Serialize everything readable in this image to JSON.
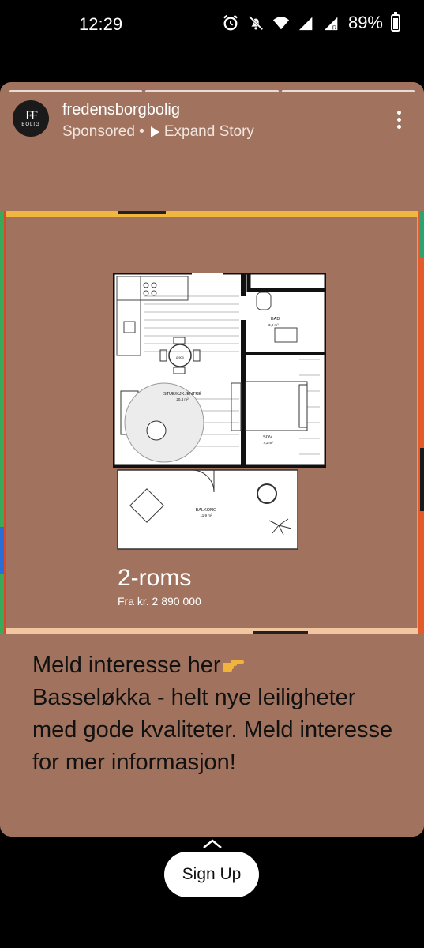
{
  "status_bar": {
    "time": "12:29",
    "battery": "89%",
    "icons": [
      "alarm-icon",
      "mute-icon",
      "wifi-icon",
      "signal-icon",
      "signal-roaming-icon",
      "battery-icon"
    ]
  },
  "story": {
    "background": "#a1735e",
    "segments": 3,
    "account": {
      "handle": "fredensborgbolig",
      "avatar_text": "FF",
      "avatar_subtext": "BOLIG"
    },
    "sponsored_label": "Sponsored •",
    "expand_label": "Expand Story",
    "ad": {
      "plan_labels": {
        "bad": "BAD",
        "bad_area": "3,9 m²",
        "stue": "STUE/KJK./ENTRÉ",
        "stue_area": "20,4 m²",
        "sov": "SOV",
        "sov_area": "7,1 m²",
        "balkong": "BALKONG",
        "balkong_area": "11,9 m²",
        "table_label": "Ø900"
      },
      "rooms": "2-roms",
      "price": "Fra kr. 2 890 000"
    },
    "caption": "Meld interesse her",
    "caption_emoji": "pointing-right-icon",
    "caption_rest": "Basseløkka - helt nye leiligheter med gode kvaliteter. Meld interesse for mer informasjon!"
  },
  "cta": {
    "label": "Sign Up"
  }
}
